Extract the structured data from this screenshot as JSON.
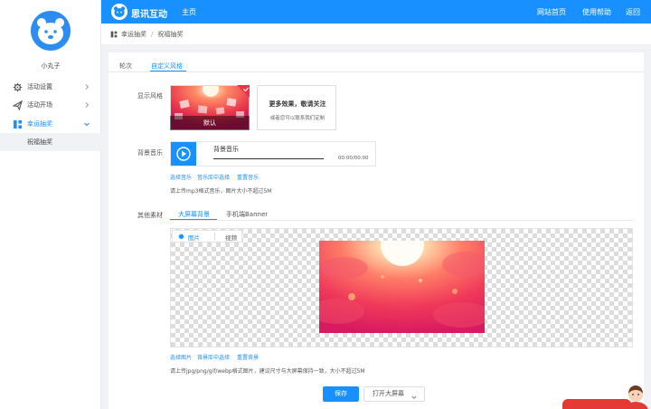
{
  "sidebar": {
    "username": "小丸子",
    "items": [
      {
        "label": "活动设置",
        "icon": "gear-icon"
      },
      {
        "label": "活动开场",
        "icon": "send-icon"
      },
      {
        "label": "幸运抽奖",
        "icon": "grid-icon"
      }
    ],
    "sub_item": "祝福抽奖"
  },
  "header": {
    "brand": "思讯互动",
    "home": "主页",
    "links": [
      "网站首页",
      "使用帮助",
      "返回"
    ]
  },
  "breadcrumb": {
    "items": [
      "幸运抽奖",
      "祝福抽奖"
    ],
    "separator": "/"
  },
  "tabs": [
    "轮次",
    "自定义风格"
  ],
  "style": {
    "label": "显示风格",
    "default_caption": "默认",
    "more_title": "更多效果，敬请关注",
    "more_sub": "或者您可以联系我们定制"
  },
  "music": {
    "label": "背景音乐",
    "title": "背景音乐",
    "time": "00:00/00:00",
    "links": [
      "选择音乐",
      "音乐库中选择",
      "重置音乐"
    ],
    "hint": "请上传mp3格式音乐，图片大小不超过5M"
  },
  "materials": {
    "label": "其他素材",
    "subtabs": [
      "大屏幕背景",
      "手机端Banner"
    ],
    "mode_options": [
      "图片",
      "视频"
    ],
    "links": [
      "选择图片",
      "背景库中选择",
      "重置背景"
    ],
    "hint": "请上传jpg/png/gif/webp格式图片，建议尺寸与大屏幕保持一致，大小不超过5M"
  },
  "actions": {
    "save": "保存",
    "open": "打开大屏幕"
  },
  "colors": {
    "primary": "#1890ff",
    "accent_red": "#e8334a"
  }
}
